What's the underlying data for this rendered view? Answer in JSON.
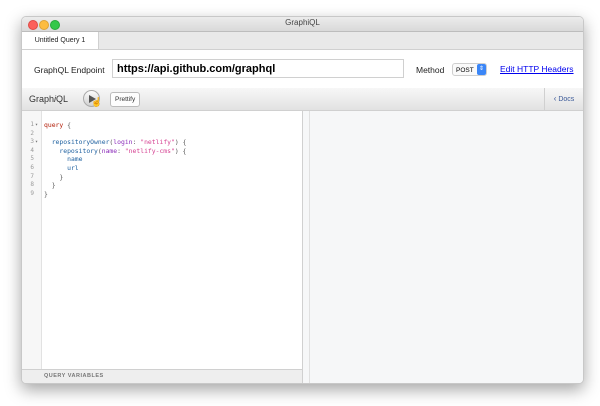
{
  "window": {
    "title": "GraphiQL"
  },
  "tabs": [
    {
      "label": "Untitled Query 1"
    }
  ],
  "endpoint": {
    "label": "GraphQL Endpoint",
    "url": "https://api.github.com/graphql",
    "method_label": "Method",
    "method_value": "POST",
    "headers_link": "Edit HTTP Headers"
  },
  "toolbar": {
    "logo_prefix": "Graph",
    "logo_italic": "i",
    "logo_suffix": "QL",
    "prettify_label": "Prettify",
    "docs_label": "Docs"
  },
  "editor": {
    "line_numbers": [
      "1",
      "2",
      "3",
      "4",
      "5",
      "6",
      "7",
      "8",
      "9"
    ],
    "lines": [
      {
        "tokens": [
          [
            "kw",
            "query"
          ],
          [
            "punc",
            " {"
          ]
        ]
      },
      {
        "tokens": []
      },
      {
        "tokens": [
          [
            "punc",
            "  "
          ],
          [
            "def",
            "repositoryOwner"
          ],
          [
            "punc",
            "("
          ],
          [
            "attr",
            "login"
          ],
          [
            "punc",
            ": "
          ],
          [
            "str",
            "\"netlify\""
          ],
          [
            "punc",
            ") {"
          ]
        ]
      },
      {
        "tokens": [
          [
            "punc",
            "    "
          ],
          [
            "def",
            "repository"
          ],
          [
            "punc",
            "("
          ],
          [
            "attr",
            "name"
          ],
          [
            "punc",
            ": "
          ],
          [
            "str",
            "\"netlify-cms\""
          ],
          [
            "punc",
            ") {"
          ]
        ]
      },
      {
        "tokens": [
          [
            "punc",
            "      "
          ],
          [
            "field",
            "name"
          ]
        ]
      },
      {
        "tokens": [
          [
            "punc",
            "      "
          ],
          [
            "field",
            "url"
          ]
        ]
      },
      {
        "tokens": [
          [
            "punc",
            "    }"
          ]
        ]
      },
      {
        "tokens": [
          [
            "punc",
            "  }"
          ]
        ]
      },
      {
        "tokens": [
          [
            "punc",
            "}"
          ]
        ]
      }
    ]
  },
  "variables": {
    "label": "QUERY VARIABLES"
  },
  "colors": {
    "link": "#0000ee",
    "keyword": "#b11a04",
    "string": "#d64292",
    "select_accent": "#3b86f7"
  }
}
